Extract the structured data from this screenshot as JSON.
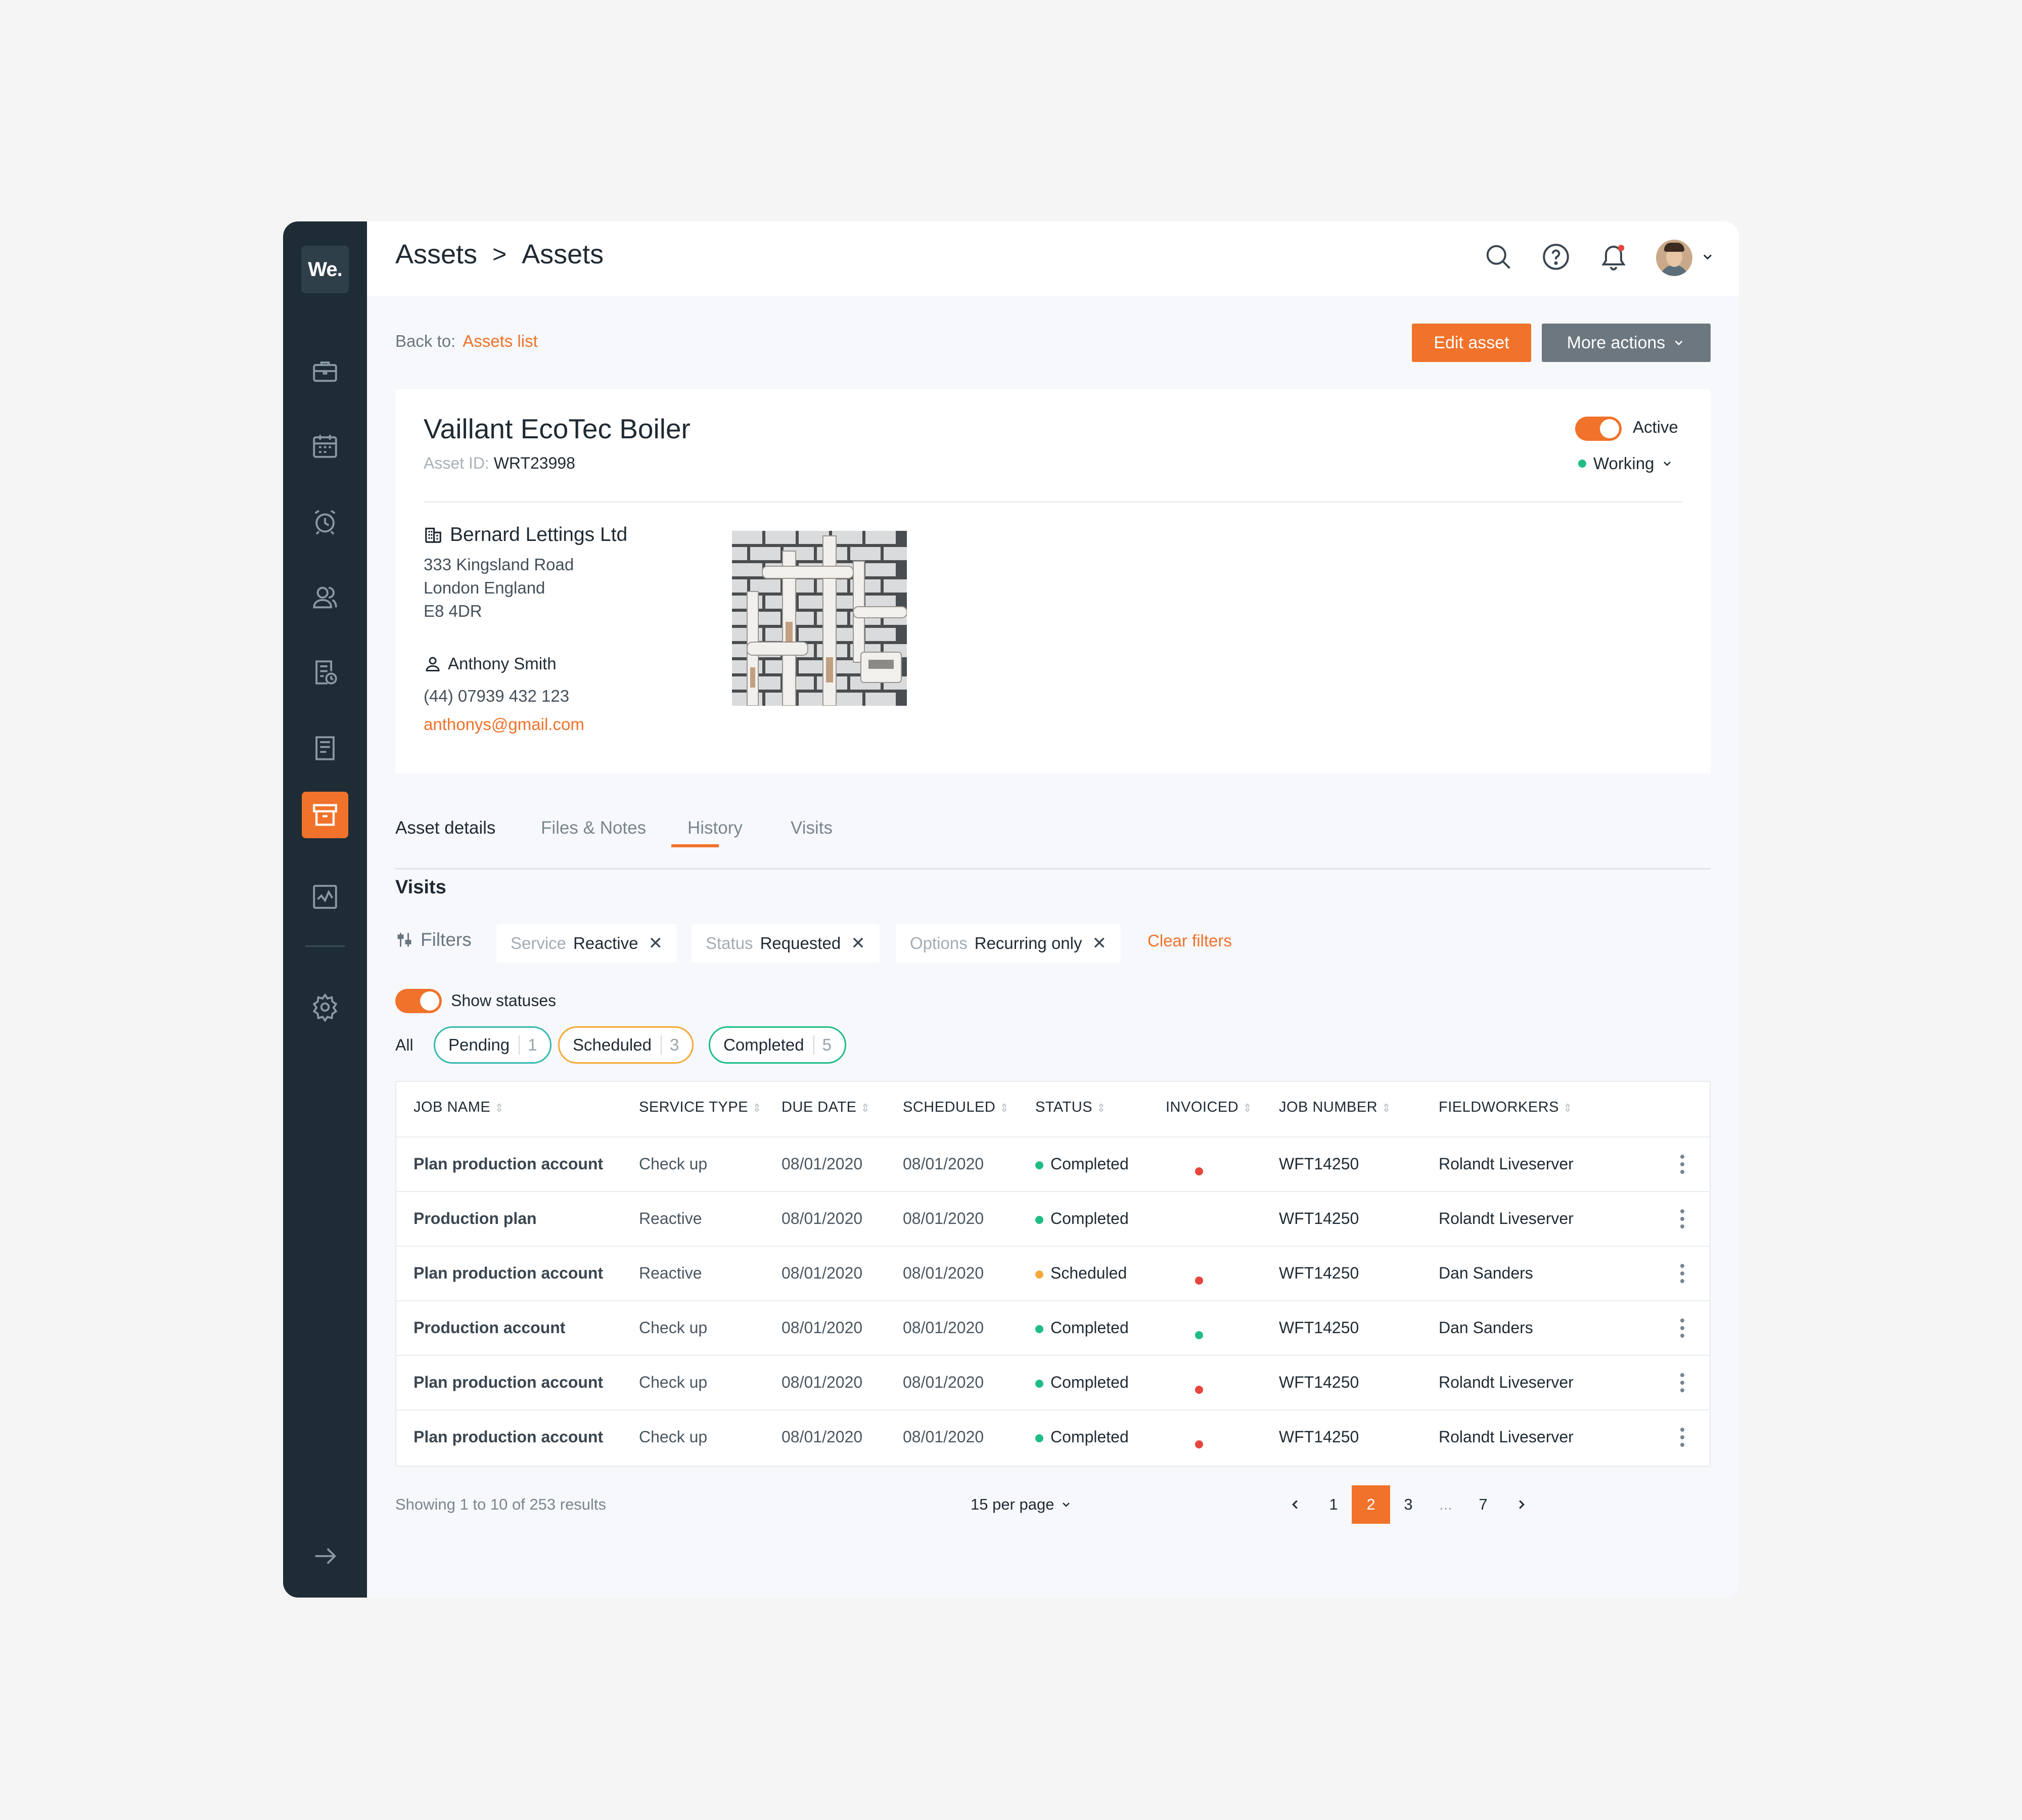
{
  "app": {
    "logo": "We."
  },
  "colors": {
    "accent": "#f1722a",
    "sidebar": "#1e2c35",
    "green": "#1fbd84",
    "red": "#e8463d",
    "amber": "#f5a938",
    "teal": "#35b9b0"
  },
  "header": {
    "breadcrumb": [
      "Assets",
      "Assets"
    ],
    "separator": ">"
  },
  "back": {
    "label": "Back to:",
    "link": "Assets list"
  },
  "actions": {
    "edit": "Edit asset",
    "more": "More actions"
  },
  "asset": {
    "title": "Vaillant EcoTec Boiler",
    "id_label": "Asset ID:",
    "id_value": "WRT23998",
    "active_label": "Active",
    "condition": "Working",
    "company": "Bernard Lettings Ltd",
    "address": [
      "333 Kingsland Road",
      "London England",
      "E8 4DR"
    ],
    "contact_name": "Anthony Smith",
    "phone": "(44) 07939 432 123",
    "email": "anthonys@gmail.com"
  },
  "tabs": [
    "Asset details",
    "Files & Notes",
    "History",
    "Visits"
  ],
  "active_tab": "Visits",
  "visits": {
    "title": "Visits",
    "filters_label": "Filters",
    "filters": [
      {
        "key": "Service",
        "value": "Reactive"
      },
      {
        "key": "Status",
        "value": "Requested"
      },
      {
        "key": "Options",
        "value": "Recurring only"
      }
    ],
    "clear_filters": "Clear filters",
    "show_statuses": "Show statuses",
    "status_all": "All",
    "status_pills": [
      {
        "label": "Pending",
        "count": "1"
      },
      {
        "label": "Scheduled",
        "count": "3"
      },
      {
        "label": "Completed",
        "count": "5"
      }
    ]
  },
  "table": {
    "columns": [
      "JOB NAME",
      "SERVICE TYPE",
      "DUE DATE",
      "SCHEDULED",
      "STATUS",
      "INVOICED",
      "JOB NUMBER",
      "FIELDWORKERS"
    ],
    "rows": [
      {
        "job": "Plan production account",
        "service": "Check up",
        "due": "08/01/2020",
        "scheduled": "08/01/2020",
        "status": "Completed",
        "status_color": "green",
        "invoiced": "red",
        "number": "WFT14250",
        "worker": "Rolandt Liveserver"
      },
      {
        "job": "Production plan",
        "service": "Reactive",
        "due": "08/01/2020",
        "scheduled": "08/01/2020",
        "status": "Completed",
        "status_color": "green",
        "invoiced": "none",
        "number": "WFT14250",
        "worker": "Rolandt Liveserver"
      },
      {
        "job": "Plan production account",
        "service": "Reactive",
        "due": "08/01/2020",
        "scheduled": "08/01/2020",
        "status": "Scheduled",
        "status_color": "amber",
        "invoiced": "red",
        "number": "WFT14250",
        "worker": "Dan Sanders"
      },
      {
        "job": "Production account",
        "service": "Check up",
        "due": "08/01/2020",
        "scheduled": "08/01/2020",
        "status": "Completed",
        "status_color": "green",
        "invoiced": "green",
        "number": "WFT14250",
        "worker": "Dan Sanders"
      },
      {
        "job": "Plan production account",
        "service": "Check up",
        "due": "08/01/2020",
        "scheduled": "08/01/2020",
        "status": "Completed",
        "status_color": "green",
        "invoiced": "red",
        "number": "WFT14250",
        "worker": "Rolandt Liveserver"
      },
      {
        "job": "Plan production account",
        "service": "Check up",
        "due": "08/01/2020",
        "scheduled": "08/01/2020",
        "status": "Completed",
        "status_color": "green",
        "invoiced": "red",
        "number": "WFT14250",
        "worker": "Rolandt Liveserver"
      }
    ]
  },
  "pagination": {
    "showing": "Showing 1 to 10 of 253 results",
    "per_page": "15 per page",
    "pages": [
      "1",
      "2",
      "3",
      "...",
      "7"
    ],
    "current": "2"
  },
  "icons": {
    "sidebar": [
      "briefcase-icon",
      "calendar-icon",
      "alarm-icon",
      "users-icon",
      "report-clock-icon",
      "document-icon",
      "archive-icon",
      "activity-chart-icon",
      "settings-icon",
      "arrow-right-icon"
    ],
    "header": [
      "search-icon",
      "help-icon",
      "bell-icon",
      "avatar",
      "chevron-down-icon"
    ]
  }
}
